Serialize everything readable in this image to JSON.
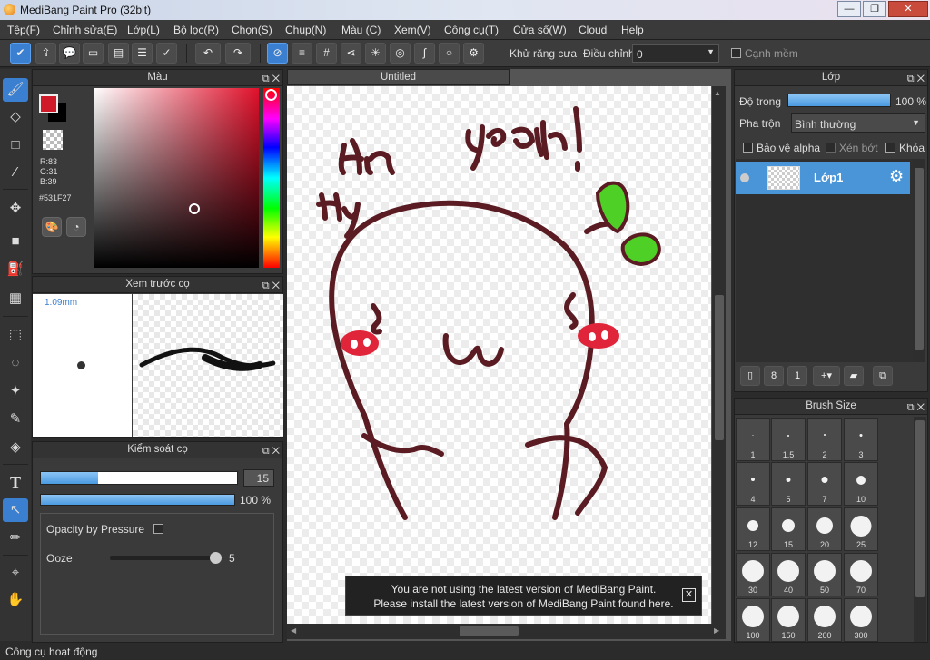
{
  "window": {
    "title": "MediBang Paint Pro (32bit)",
    "minimize": "—",
    "restore": "❐",
    "close": "✕"
  },
  "menu": [
    "Tệp(F)",
    "Chỉnh sửa(E)",
    "Lớp(L)",
    "Bộ lọc(R)",
    "Chọn(S)",
    "Chụp(N)",
    "Màu (C)",
    "Xem(V)",
    "Công cụ(T)",
    "Cửa sổ(W)",
    "Cloud",
    "Help"
  ],
  "toolbar": {
    "antialias_label": "Khử răng cưa",
    "adjust_label": "Điều chỉnh",
    "adjust_value": "0",
    "soft_edge_label": "Cạnh mềm"
  },
  "color_panel": {
    "title": "Màu",
    "r": "R:83",
    "g": "G:31",
    "b": "B:39",
    "hex": "#531F27",
    "primary": "#d01a2a",
    "secondary": "#000000"
  },
  "brush_preview": {
    "title": "Xem trước cọ",
    "size": "1.09mm"
  },
  "brush_control": {
    "title": "Kiểm soát cọ",
    "size_value": "15",
    "opacity_value": "100 %",
    "opacity_pressure_label": "Opacity by Pressure",
    "ooze_label": "Ooze",
    "ooze_value": "5"
  },
  "canvas": {
    "tab": "Untitled",
    "notice_line1": "You are not using the latest version of MediBang Paint.",
    "notice_line2": "Please install the latest version of MediBang Paint found here.",
    "notice_close": "✕"
  },
  "layer_panel": {
    "title": "Lớp",
    "opacity_label": "Độ trong",
    "opacity_value": "100 %",
    "blend_label": "Pha trộn",
    "blend_value": "Bình thường",
    "protect_alpha": "Bảo vệ alpha",
    "clip": "Xén bớt",
    "lock": "Khóa",
    "layer_name": "Lớp1"
  },
  "brush_size_panel": {
    "title": "Brush Size",
    "sizes": [
      "1",
      "1.5",
      "2",
      "3",
      "4",
      "5",
      "7",
      "10",
      "12",
      "15",
      "20",
      "25",
      "30",
      "40",
      "50",
      "70",
      "100",
      "150",
      "200",
      "300"
    ]
  },
  "status": "Công cụ hoạt động",
  "drawing_text": {
    "yeah": "yeah!",
    "an": "An",
    "hy": "Hy"
  }
}
